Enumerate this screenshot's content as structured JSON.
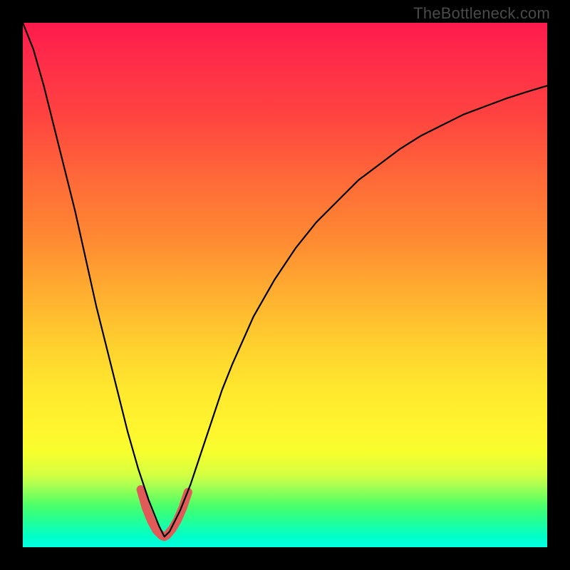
{
  "watermark": "TheBottleneck.com",
  "chart_data": {
    "type": "line",
    "title": "",
    "xlabel": "",
    "ylabel": "",
    "xlim": [
      0,
      100
    ],
    "ylim": [
      0,
      100
    ],
    "note": "V-shaped bottleneck curve; y is estimated bottleneck percentage (0 = ideal match). No axes, ticks, or legend visible. Minimum near x≈27. Red marker segment highlights the trough.",
    "series": [
      {
        "name": "curve",
        "x": [
          0,
          2,
          4,
          6,
          8,
          10,
          12,
          14,
          16,
          18,
          20,
          22,
          24,
          26,
          27,
          28,
          30,
          32,
          34,
          36,
          38,
          40,
          44,
          48,
          52,
          56,
          60,
          64,
          68,
          72,
          76,
          80,
          84,
          88,
          92,
          96,
          100
        ],
        "y": [
          100,
          95,
          88,
          80,
          72,
          64,
          55,
          46,
          38,
          30,
          22,
          15,
          9,
          4,
          2,
          3,
          7,
          12,
          18,
          24,
          30,
          35,
          44,
          51,
          57,
          62,
          66,
          70,
          73,
          76,
          78.5,
          80.5,
          82.5,
          84,
          85.5,
          86.8,
          88
        ]
      },
      {
        "name": "trough-highlight",
        "x": [
          22.5,
          23.5,
          24.5,
          25.5,
          26.5,
          27,
          27.5,
          28.5,
          29.5,
          30.5,
          31.5
        ],
        "y": [
          11,
          7.5,
          5,
          3.2,
          2.2,
          2,
          2.3,
          3.5,
          5.2,
          7.5,
          10.5
        ]
      }
    ]
  },
  "styles": {
    "curve_stroke": "#000000",
    "curve_width": 2.2,
    "trough_stroke": "#e15a5a",
    "trough_width": 12
  }
}
